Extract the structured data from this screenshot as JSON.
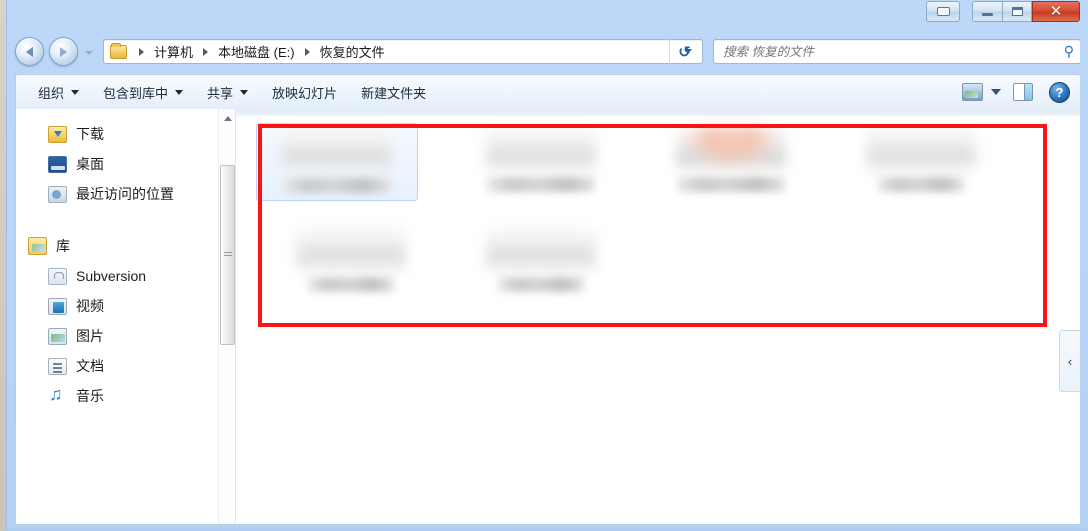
{
  "window": {
    "caption_buttons": {
      "extra_label": "▭",
      "minimize_label": "–",
      "maximize_label": "□",
      "close_label": "✕"
    },
    "accent_blue": "#b7d4f5",
    "close_red": "#d44a30"
  },
  "navigation": {
    "back_name": "后退",
    "forward_name": "前进",
    "history_name": "最近的位置",
    "refresh_glyph": "↺"
  },
  "address_bar": {
    "folder_icon": "folder-icon",
    "breadcrumb": [
      "计算机",
      "本地磁盘 (E:)",
      "恢复的文件"
    ],
    "dropdown_label": "▼"
  },
  "search": {
    "placeholder": "搜索 恢复的文件",
    "value": "",
    "icon_glyph": "⚲"
  },
  "toolbar": {
    "items": [
      {
        "label": "组织",
        "has_caret": true
      },
      {
        "label": "包含到库中",
        "has_caret": true
      },
      {
        "label": "共享",
        "has_caret": true
      },
      {
        "label": "放映幻灯片",
        "has_caret": false
      },
      {
        "label": "新建文件夹",
        "has_caret": false
      }
    ],
    "view_icon": "view-layout-icon",
    "view_caret": "▼",
    "preview_pane_icon": "preview-pane-icon",
    "help_label": "?"
  },
  "sidebar": {
    "items": [
      {
        "label": "下载",
        "icon": "downloads-icon",
        "group": false
      },
      {
        "label": "桌面",
        "icon": "desktop-icon",
        "group": false
      },
      {
        "label": "最近访问的位置",
        "icon": "recent-places-icon",
        "group": false
      },
      {
        "label": "库",
        "icon": "library-icon",
        "group": true
      },
      {
        "label": "Subversion",
        "icon": "subversion-icon",
        "group": false
      },
      {
        "label": "视频",
        "icon": "video-icon",
        "group": false
      },
      {
        "label": "图片",
        "icon": "pictures-icon",
        "group": false
      },
      {
        "label": "文档",
        "icon": "documents-icon",
        "group": false
      },
      {
        "label": "音乐",
        "icon": "music-icon",
        "group": false
      }
    ],
    "scrollbar_up_glyph": "▲"
  },
  "content": {
    "files": [
      {
        "name": "",
        "thumb": "document-thumb",
        "selected": true
      },
      {
        "name": "",
        "thumb": "document-thumb",
        "selected": false
      },
      {
        "name": "",
        "thumb": "photo-thumb",
        "selected": false
      },
      {
        "name": "",
        "thumb": "document-thumb",
        "selected": false
      },
      {
        "name": "",
        "thumb": "document-thumb",
        "selected": false
      },
      {
        "name": "",
        "thumb": "document-thumb",
        "selected": false
      }
    ]
  },
  "annotation": {
    "red_box_color": "#fb1414",
    "red_box_label": "highlighted-file-area"
  },
  "preview_expander": {
    "glyph": "‹"
  }
}
